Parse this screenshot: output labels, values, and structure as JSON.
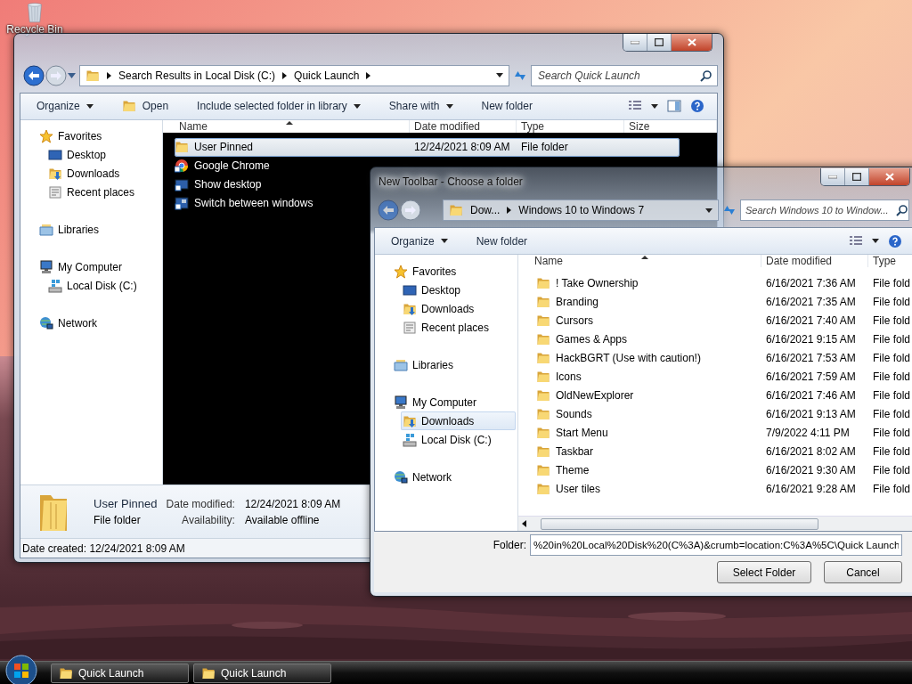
{
  "desktop": {
    "icons": [
      {
        "label": "Recycle Bin"
      }
    ]
  },
  "explorer": {
    "address": {
      "crumbs": [
        "Search Results in Local Disk (C:)",
        "Quick Launch"
      ]
    },
    "search": {
      "placeholder": "Search Quick Launch"
    },
    "toolbar": [
      {
        "label": "Organize",
        "kind": "menu"
      },
      {
        "label": "Open",
        "kind": "launch"
      },
      {
        "label": "Include selected folder in library",
        "kind": "menu"
      },
      {
        "label": "Share with",
        "kind": "menu"
      },
      {
        "label": "New folder",
        "kind": "command"
      }
    ],
    "nav": [
      {
        "label": "Favorites",
        "kind": "star",
        "selected": false,
        "children": [
          {
            "label": "Desktop",
            "kind": "desktop",
            "selected": false
          },
          {
            "label": "Downloads",
            "kind": "downloads",
            "selected": false
          },
          {
            "label": "Recent places",
            "kind": "recent",
            "selected": false
          }
        ]
      },
      {
        "label": "Libraries",
        "kind": "libraries",
        "selected": false
      },
      {
        "label": "My Computer",
        "kind": "computer",
        "selected": false,
        "children": [
          {
            "label": "Local Disk (C:)",
            "kind": "disk",
            "selected": false
          }
        ]
      },
      {
        "label": "Network",
        "kind": "network",
        "selected": false
      }
    ],
    "columns": [
      "Name",
      "Date modified",
      "Type",
      "Size"
    ],
    "rows": [
      {
        "name": "User Pinned",
        "date": "12/24/2021 8:09 AM",
        "type": "File folder",
        "kind": "folder",
        "selected": true
      },
      {
        "name": "Google Chrome",
        "kind": "app",
        "selected": false
      },
      {
        "name": "Show desktop",
        "kind": "screen",
        "selected": false
      },
      {
        "name": "Switch between windows",
        "kind": "window",
        "selected": false
      }
    ],
    "details": {
      "name": "User Pinned",
      "type": "File folder",
      "fields": [
        {
          "label": "Date modified:",
          "value": "12/24/2021 8:09 AM"
        },
        {
          "label": "Availability:",
          "value": "Available offline"
        }
      ]
    },
    "status_bar": "Date created: 12/24/2021 8:09 AM"
  },
  "dialog": {
    "title": "New Toolbar - Choose a folder",
    "address": {
      "crumbs": [
        "Dow...",
        "Windows 10 to Windows 7"
      ]
    },
    "search": {
      "placeholder": "Search Windows 10 to Window..."
    },
    "toolbar": [
      {
        "label": "Organize",
        "kind": "menu"
      },
      {
        "label": "New folder",
        "kind": "command"
      }
    ],
    "nav": [
      {
        "label": "Favorites",
        "kind": "star",
        "selected": false,
        "children": [
          {
            "label": "Desktop",
            "kind": "desktop",
            "selected": false
          },
          {
            "label": "Downloads",
            "kind": "downloads",
            "selected": false
          },
          {
            "label": "Recent places",
            "kind": "recent",
            "selected": false
          }
        ]
      },
      {
        "label": "Libraries",
        "kind": "libraries",
        "selected": false
      },
      {
        "label": "My Computer",
        "kind": "computer",
        "selected": false,
        "children": [
          {
            "label": "Downloads",
            "kind": "downloads",
            "selected": true
          },
          {
            "label": "Local Disk (C:)",
            "kind": "disk",
            "selected": false
          }
        ]
      },
      {
        "label": "Network",
        "kind": "network",
        "selected": false
      }
    ],
    "columns": [
      "Name",
      "Date modified",
      "Type"
    ],
    "rows": [
      {
        "name": "! Take Ownership",
        "date": "6/16/2021 7:36 AM",
        "type": "File fold",
        "kind": "folder",
        "selected": false
      },
      {
        "name": "Branding",
        "date": "6/16/2021 7:35 AM",
        "type": "File fold",
        "kind": "folder",
        "selected": false
      },
      {
        "name": "Cursors",
        "date": "6/16/2021 7:40 AM",
        "type": "File fold",
        "kind": "folder",
        "selected": false
      },
      {
        "name": "Games & Apps",
        "date": "6/16/2021 9:15 AM",
        "type": "File fold",
        "kind": "folder",
        "selected": false
      },
      {
        "name": "HackBGRT (Use with caution!)",
        "date": "6/16/2021 7:53 AM",
        "type": "File fold",
        "kind": "folder",
        "selected": false
      },
      {
        "name": "Icons",
        "date": "6/16/2021 7:59 AM",
        "type": "File fold",
        "kind": "folder",
        "selected": false
      },
      {
        "name": "OldNewExplorer",
        "date": "6/16/2021 7:46 AM",
        "type": "File fold",
        "kind": "folder",
        "selected": false
      },
      {
        "name": "Sounds",
        "date": "6/16/2021 9:13 AM",
        "type": "File fold",
        "kind": "folder",
        "selected": false
      },
      {
        "name": "Start Menu",
        "date": "7/9/2022 4:11 PM",
        "type": "File fold",
        "kind": "folder",
        "selected": false
      },
      {
        "name": "Taskbar",
        "date": "6/16/2021 8:02 AM",
        "type": "File fold",
        "kind": "folder",
        "selected": false
      },
      {
        "name": "Theme",
        "date": "6/16/2021 9:30 AM",
        "type": "File fold",
        "kind": "folder",
        "selected": false
      },
      {
        "name": "User tiles",
        "date": "6/16/2021 9:28 AM",
        "type": "File fold",
        "kind": "folder",
        "selected": false
      }
    ],
    "folder": {
      "label": "Folder:",
      "value": "%20in%20Local%20Disk%20(C%3A)&crumb=location:C%3A%5C\\Quick Launch"
    },
    "buttons": [
      {
        "label": "Select Folder"
      },
      {
        "label": "Cancel"
      }
    ]
  },
  "taskbar": {
    "buttons": [
      {
        "label": "Quick Launch"
      },
      {
        "label": "Quick Launch"
      }
    ]
  }
}
